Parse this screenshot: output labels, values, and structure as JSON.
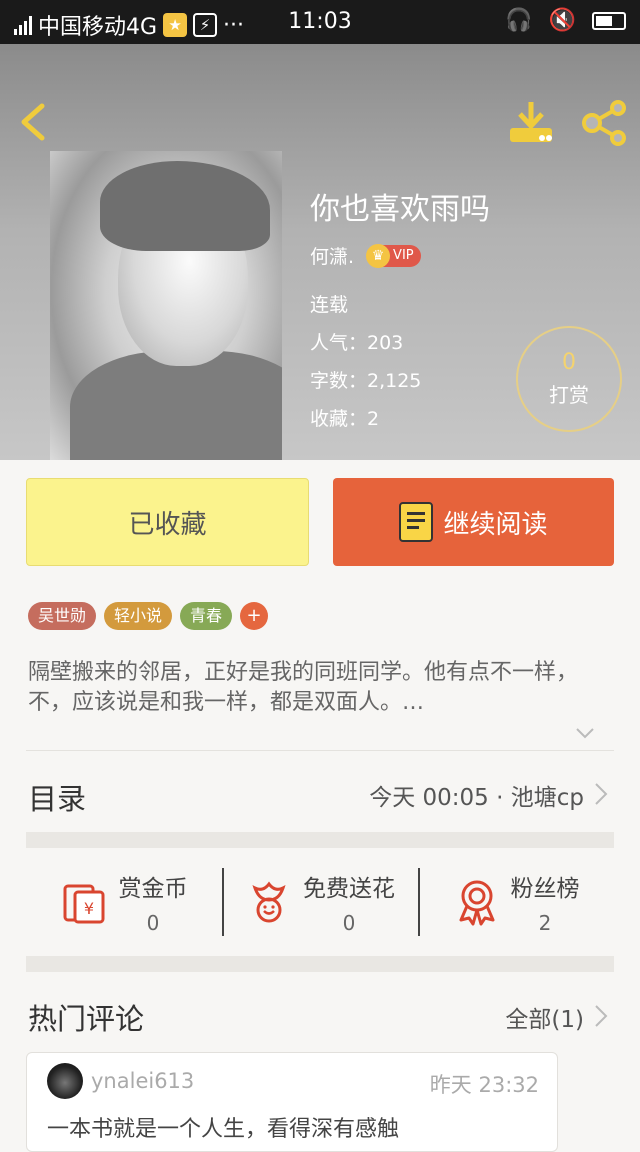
{
  "status_bar": {
    "carrier": "中国移动4G",
    "network_label": "4G",
    "time": "11:03",
    "dots": "···"
  },
  "book": {
    "title": "你也喜欢雨吗",
    "author": "何潇.",
    "vip_label": "VIP",
    "status": "连载",
    "popularity": "人气：203",
    "word_count": "字数：2,125",
    "favorites": "收藏：2",
    "tip_count": "0",
    "tip_label": "打赏"
  },
  "actions": {
    "favorited_label": "已收藏",
    "continue_label": "继续阅读"
  },
  "tags": [
    {
      "label": "吴世勋",
      "color": "#c56d5e"
    },
    {
      "label": "轻小说",
      "color": "#d39a3d"
    },
    {
      "label": "青春",
      "color": "#87a956"
    },
    {
      "label": "+",
      "color": "#e5673f"
    }
  ],
  "description": "隔壁搬来的邻居，正好是我的同班同学。他有点不一样，不，应该说是和我一样，都是双面人。…",
  "toc": {
    "title": "目录",
    "update_text": "今天 00:05 · 池塘cp"
  },
  "stats": [
    {
      "label": "赏金币",
      "value": "0",
      "icon": "red-envelope-icon"
    },
    {
      "label": "免费送花",
      "value": "0",
      "icon": "flower-icon"
    },
    {
      "label": "粉丝榜",
      "value": "2",
      "icon": "medal-icon"
    }
  ],
  "comments_section": {
    "title": "热门评论",
    "all_label": "全部(1)"
  },
  "comments": [
    {
      "user": "ynalei613",
      "time": "昨天 23:32",
      "text": "一本书就是一个人生，看得深有感触"
    }
  ],
  "colors": {
    "accent_orange": "#e6633b",
    "favorited_yellow": "#fbf38d",
    "icon_red": "#d9452f",
    "header_icon_yellow": "#f0cc3c"
  }
}
